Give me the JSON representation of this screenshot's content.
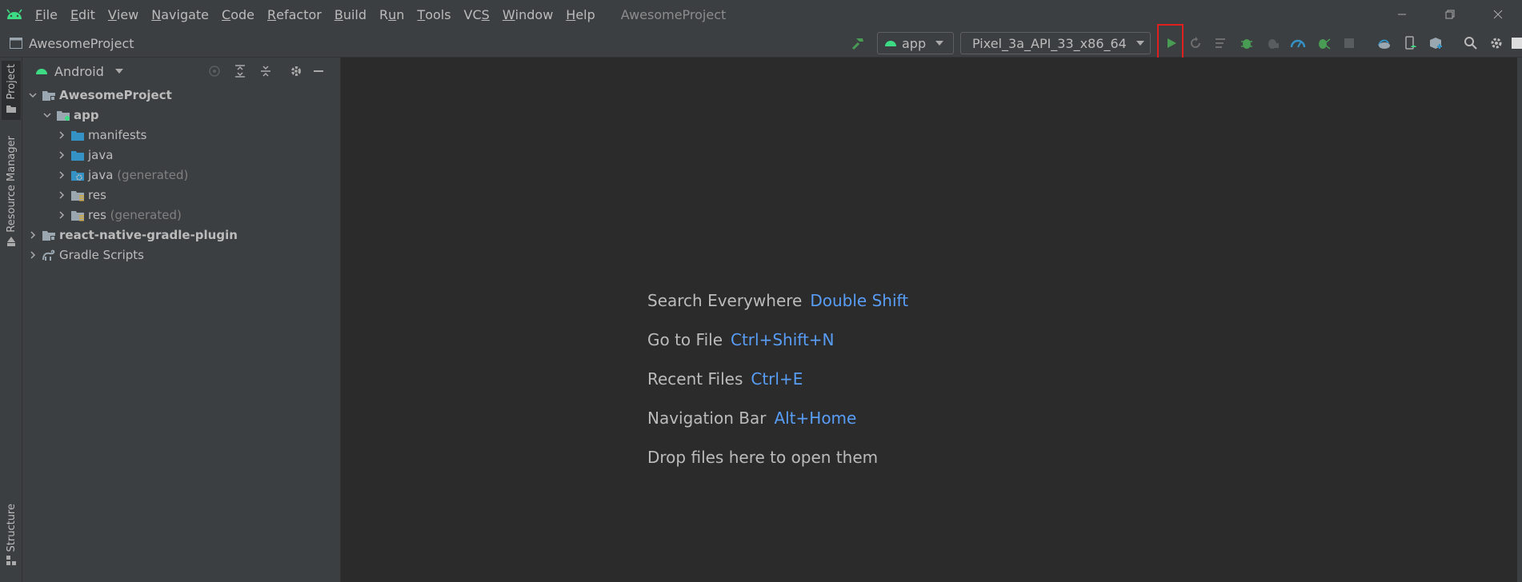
{
  "menubar": {
    "items": [
      {
        "pre": "",
        "mn": "F",
        "post": "ile"
      },
      {
        "pre": "",
        "mn": "E",
        "post": "dit"
      },
      {
        "pre": "",
        "mn": "V",
        "post": "iew"
      },
      {
        "pre": "",
        "mn": "N",
        "post": "avigate"
      },
      {
        "pre": "",
        "mn": "C",
        "post": "ode"
      },
      {
        "pre": "",
        "mn": "R",
        "post": "efactor"
      },
      {
        "pre": "",
        "mn": "B",
        "post": "uild"
      },
      {
        "pre": "R",
        "mn": "u",
        "post": "n"
      },
      {
        "pre": "",
        "mn": "T",
        "post": "ools"
      },
      {
        "pre": "VC",
        "mn": "S",
        "post": ""
      },
      {
        "pre": "",
        "mn": "W",
        "post": "indow"
      },
      {
        "pre": "",
        "mn": "H",
        "post": "elp"
      }
    ],
    "window_title": "AwesomeProject"
  },
  "toolbar": {
    "project_name": "AwesomeProject",
    "run_config": "app",
    "device": "Pixel_3a_API_33_x86_64"
  },
  "left_stripe": {
    "project_tab": "Project",
    "resource_manager_tab": "Resource Manager",
    "structure_tab": "Structure"
  },
  "project_panel": {
    "view_mode": "Android",
    "tree": [
      {
        "label": "AwesomeProject",
        "suffix": "",
        "depth": 0,
        "expanded": true,
        "bold": true,
        "icon": "module-folder-icon"
      },
      {
        "label": "app",
        "suffix": "",
        "depth": 1,
        "expanded": true,
        "bold": true,
        "icon": "app-module-icon"
      },
      {
        "label": "manifests",
        "suffix": "",
        "depth": 2,
        "expanded": false,
        "bold": false,
        "icon": "folder-icon"
      },
      {
        "label": "java",
        "suffix": "",
        "depth": 2,
        "expanded": false,
        "bold": false,
        "icon": "source-folder-icon"
      },
      {
        "label": "java",
        "suffix": " (generated)",
        "depth": 2,
        "expanded": false,
        "bold": false,
        "icon": "generated-source-folder-icon"
      },
      {
        "label": "res",
        "suffix": "",
        "depth": 2,
        "expanded": false,
        "bold": false,
        "icon": "resource-folder-icon"
      },
      {
        "label": "res",
        "suffix": " (generated)",
        "depth": 2,
        "expanded": false,
        "bold": false,
        "icon": "resource-folder-icon"
      },
      {
        "label": "react-native-gradle-plugin",
        "suffix": "",
        "depth": 0,
        "expanded": false,
        "bold": true,
        "icon": "module-folder-icon"
      },
      {
        "label": "Gradle Scripts",
        "suffix": "",
        "depth": 0,
        "expanded": false,
        "bold": false,
        "icon": "gradle-icon"
      }
    ]
  },
  "editor_hints": [
    {
      "label": "Search Everywhere",
      "shortcut": "Double Shift"
    },
    {
      "label": "Go to File",
      "shortcut": "Ctrl+Shift+N"
    },
    {
      "label": "Recent Files",
      "shortcut": "Ctrl+E"
    },
    {
      "label": "Navigation Bar",
      "shortcut": "Alt+Home"
    },
    {
      "label": "Drop files here to open them",
      "shortcut": ""
    }
  ],
  "colors": {
    "accent_green": "#3ddc84",
    "run_green": "#499c54",
    "shortcut_blue": "#589df6",
    "highlight_red": "#e02020"
  }
}
